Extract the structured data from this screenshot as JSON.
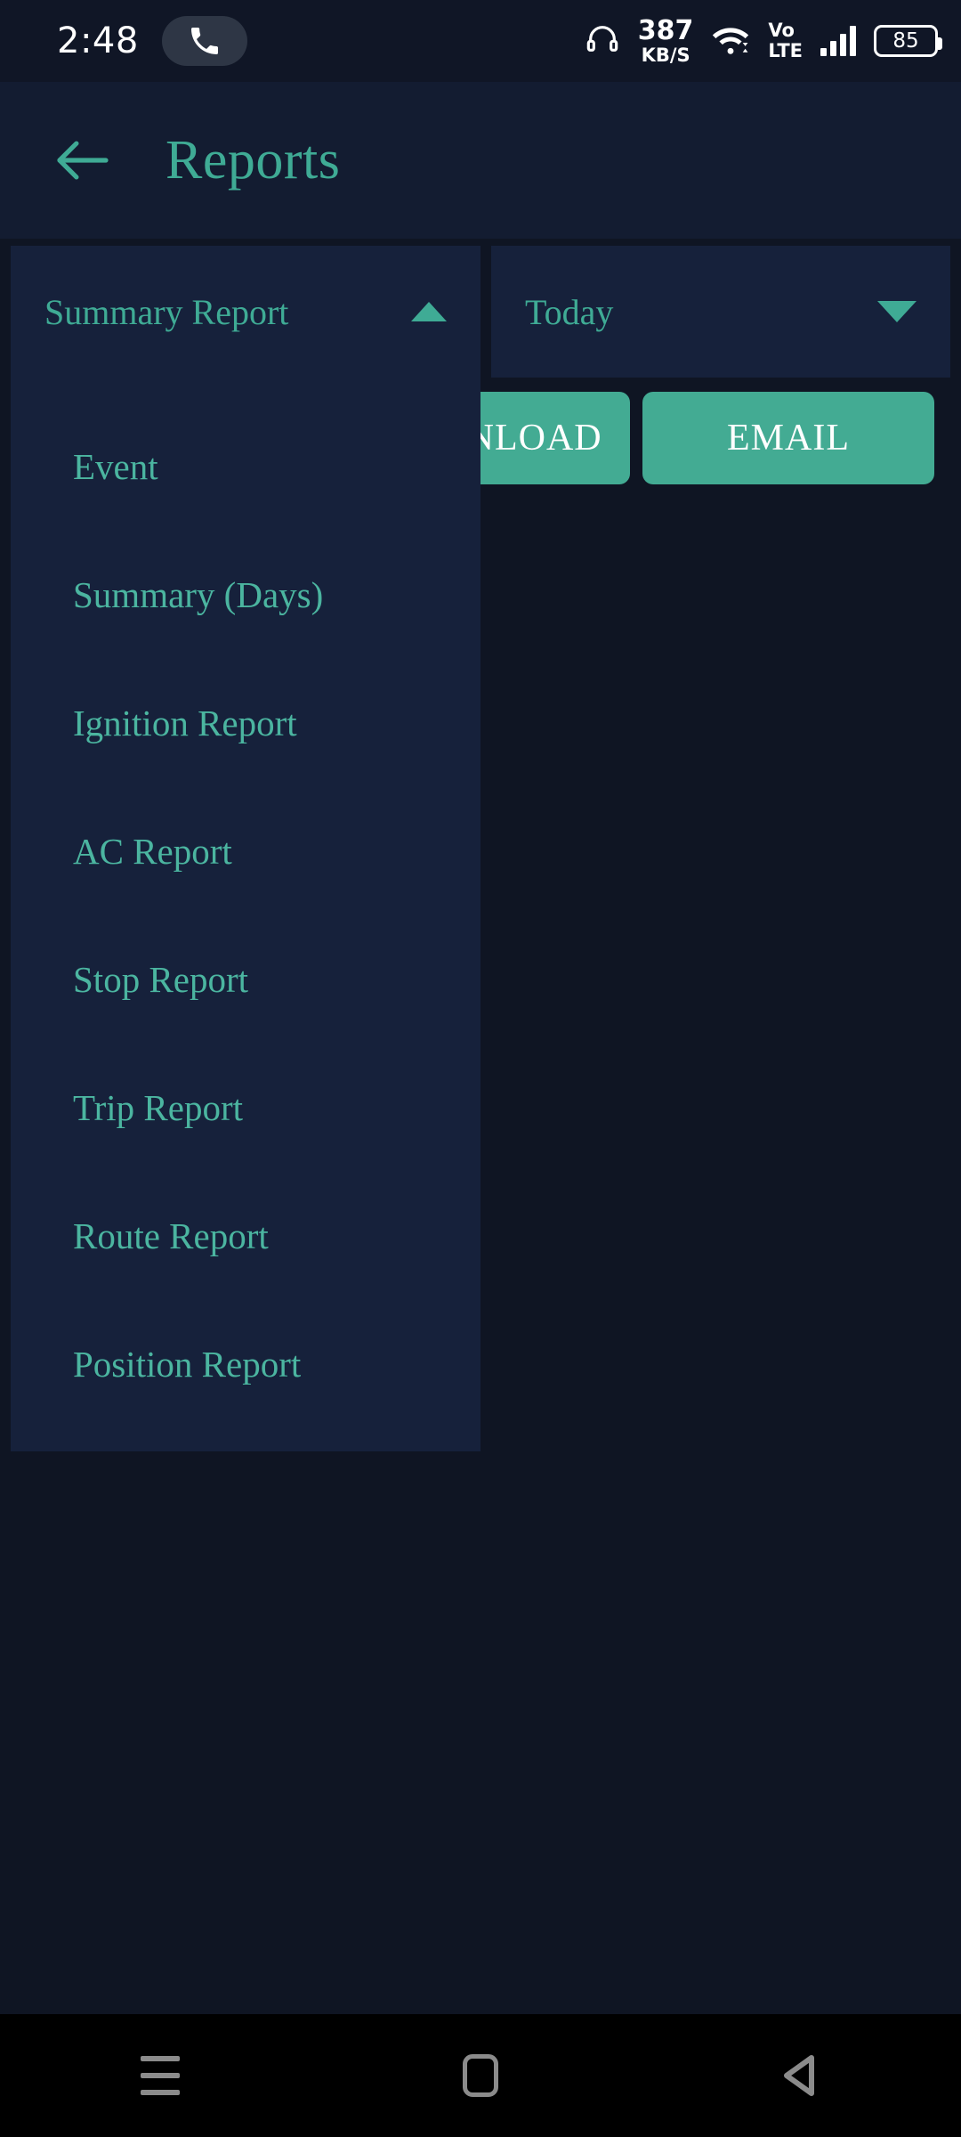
{
  "status_bar": {
    "time": "2:48",
    "call_icon": "phone-icon",
    "headset_icon": "headset-icon",
    "net_speed_value": "387",
    "net_speed_unit": "KB/S",
    "wifi_icon": "wifi-icon",
    "volte_line1": "Vo",
    "volte_line2": "LTE",
    "signal_icon": "signal-bars-icon",
    "battery_level": "85"
  },
  "app_bar": {
    "back_icon": "arrow-left-icon",
    "title": "Reports"
  },
  "filters": {
    "report_type": {
      "value": "Summary Report",
      "caret": "chevron-up-icon",
      "expanded": true
    },
    "date_range": {
      "value": "Today",
      "caret": "chevron-down-icon",
      "expanded": false
    }
  },
  "actions": {
    "download_label": "DOWNLOAD",
    "email_label": "EMAIL"
  },
  "dropdown": {
    "items": [
      {
        "label": "Event"
      },
      {
        "label": "Summary (Days)"
      },
      {
        "label": "Ignition Report"
      },
      {
        "label": "AC Report"
      },
      {
        "label": "Stop Report"
      },
      {
        "label": "Trip Report"
      },
      {
        "label": "Route Report"
      },
      {
        "label": "Position Report"
      }
    ]
  },
  "nav_bar": {
    "recents_icon": "menu-icon",
    "home_icon": "home-square-icon",
    "back_icon": "back-triangle-icon"
  },
  "colors": {
    "accent": "#43ab93",
    "accent_text": "#3fab95",
    "page_bg": "#0f1523",
    "panel_bg": "#16213b",
    "app_bar_bg": "#131c31",
    "status_bg": "#101626",
    "nav_bg": "#000000"
  }
}
